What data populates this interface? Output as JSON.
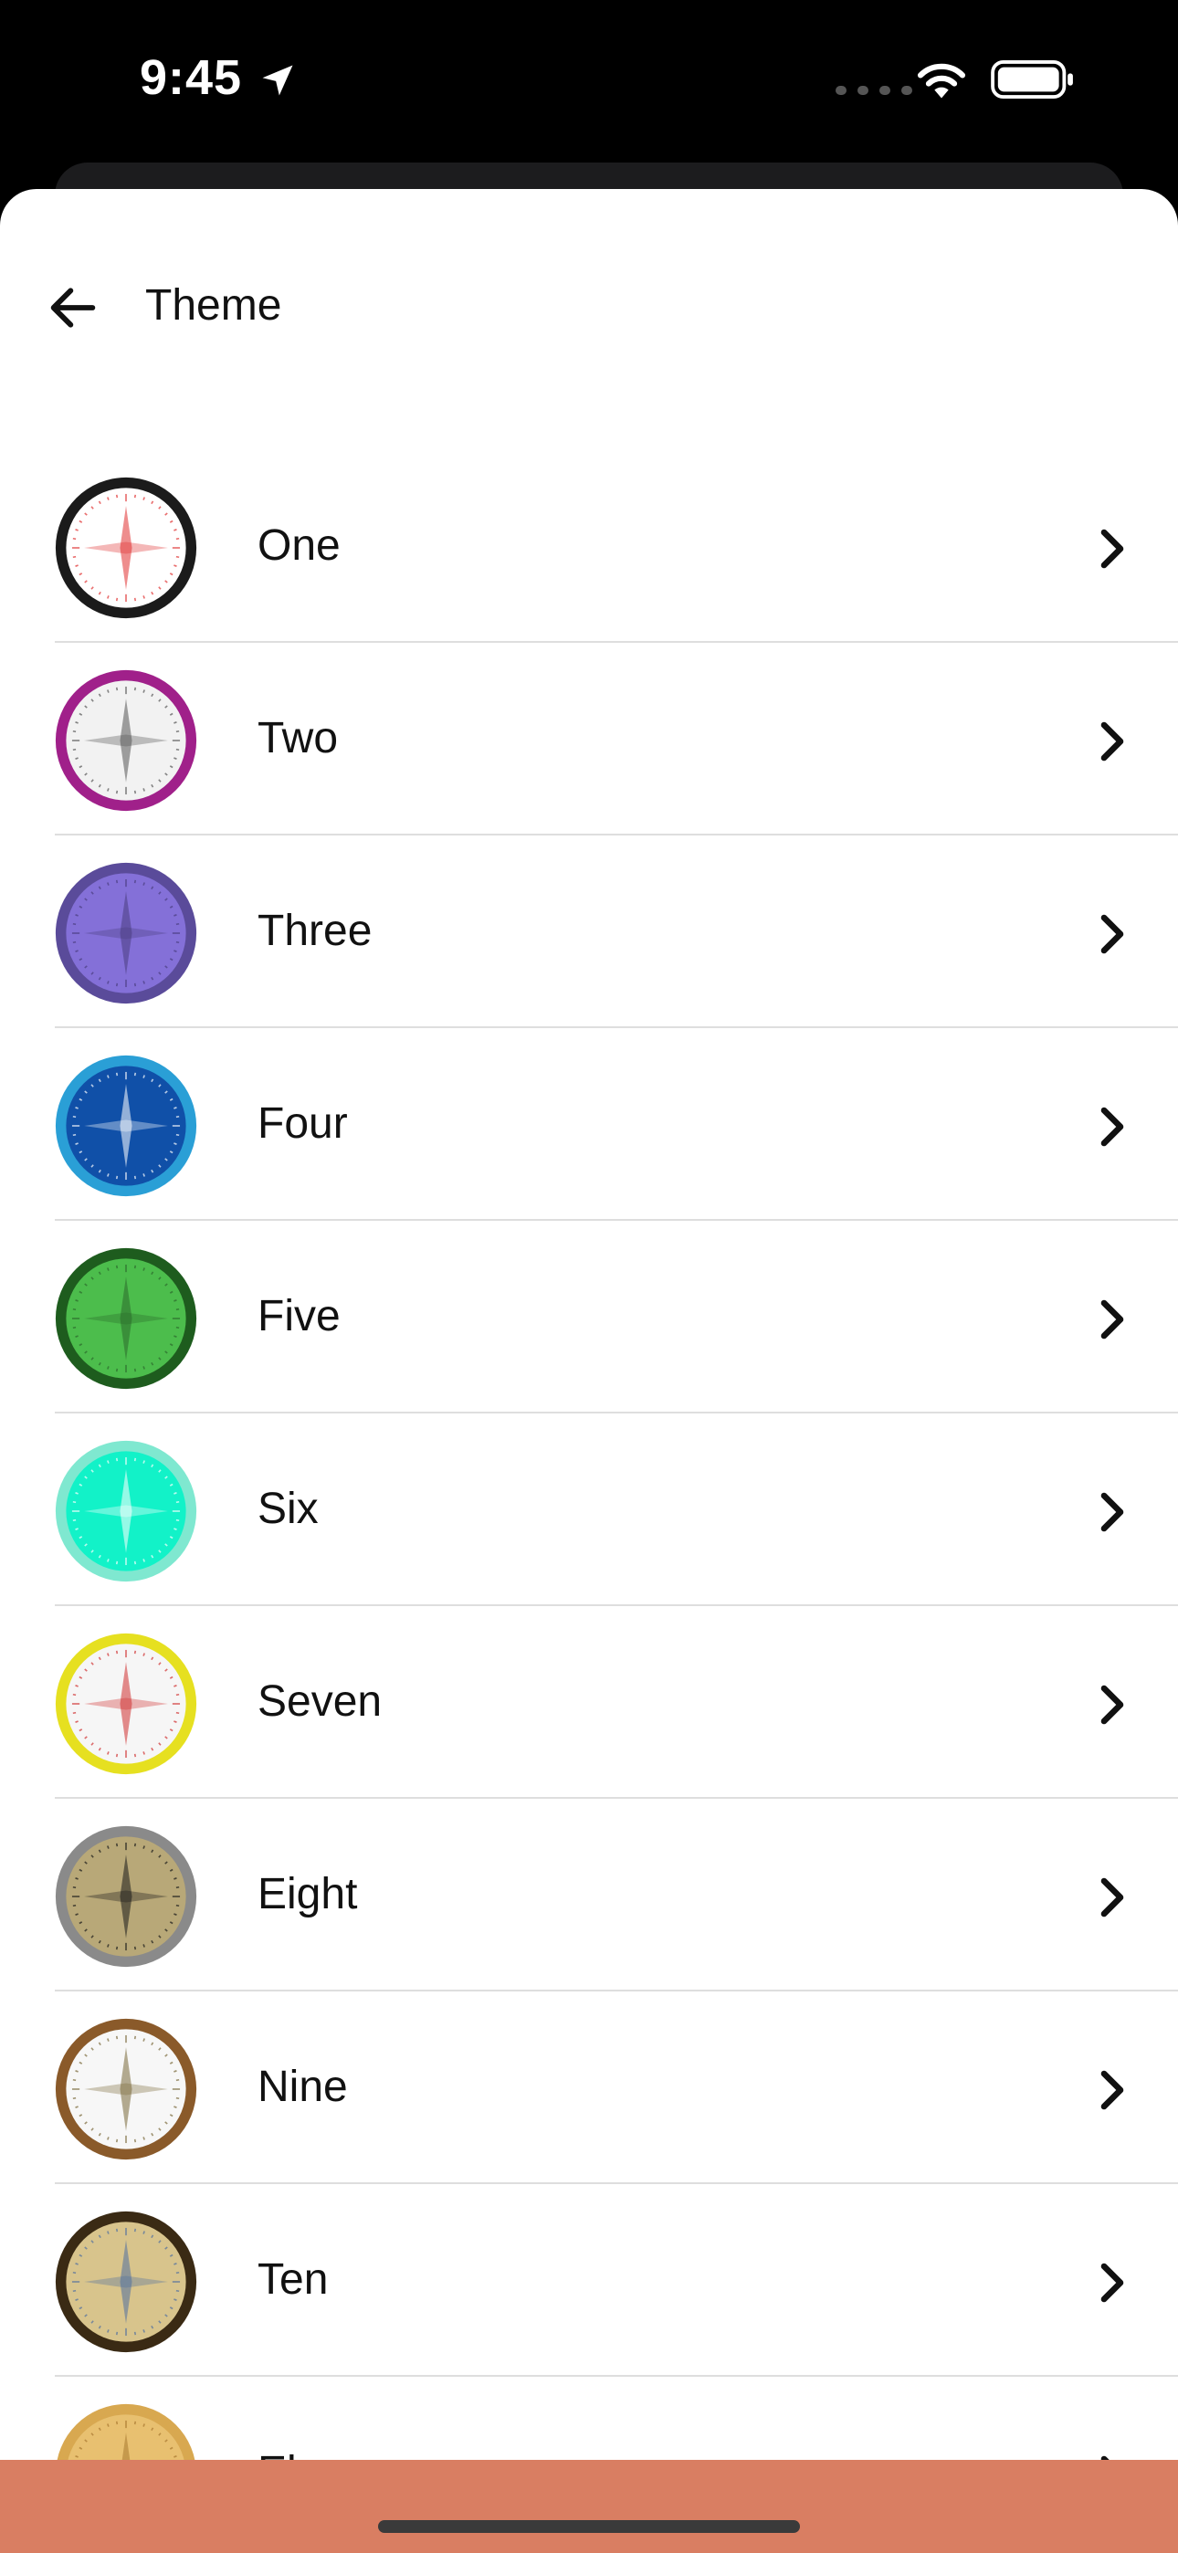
{
  "status_bar": {
    "time": "9:45"
  },
  "header": {
    "title": "Theme"
  },
  "themes": [
    {
      "label": "One",
      "ring": "#1b1b1b",
      "face": "#ffffff",
      "mark": "#e03030"
    },
    {
      "label": "Two",
      "ring": "#a0208a",
      "face": "#f2f2f2",
      "mark": "#555555"
    },
    {
      "label": "Three",
      "ring": "#5a4b9a",
      "face": "#8470d8",
      "mark": "#4a3e80"
    },
    {
      "label": "Four",
      "ring": "#2a9fd6",
      "face": "#1050a8",
      "mark": "#ffffff"
    },
    {
      "label": "Five",
      "ring": "#1e5c1e",
      "face": "#4cbd4c",
      "mark": "#2c6a2c"
    },
    {
      "label": "Six",
      "ring": "#7fe8d0",
      "face": "#12f2c8",
      "mark": "#ffffff"
    },
    {
      "label": "Seven",
      "ring": "#e6e020",
      "face": "#f6f6f6",
      "mark": "#d03030"
    },
    {
      "label": "Eight",
      "ring": "#8a8a8a",
      "face": "#b8a878",
      "mark": "#1a1a1a"
    },
    {
      "label": "Nine",
      "ring": "#8a5a2a",
      "face": "#f7f7f7",
      "mark": "#7a6a3a"
    },
    {
      "label": "Ten",
      "ring": "#3a2a14",
      "face": "#d8c48c",
      "mark": "#5070a0"
    },
    {
      "label": "Eleven",
      "ring": "#d8a850",
      "face": "#e8c070",
      "mark": "#a87830"
    }
  ],
  "colors": {
    "bottom_bar": "#d97e62",
    "divider": "#dedede"
  },
  "icons": {
    "back": "arrow-left-icon",
    "row_chevron": "chevron-right-icon",
    "location": "location-arrow-icon",
    "wifi": "wifi-icon",
    "battery": "battery-icon"
  }
}
